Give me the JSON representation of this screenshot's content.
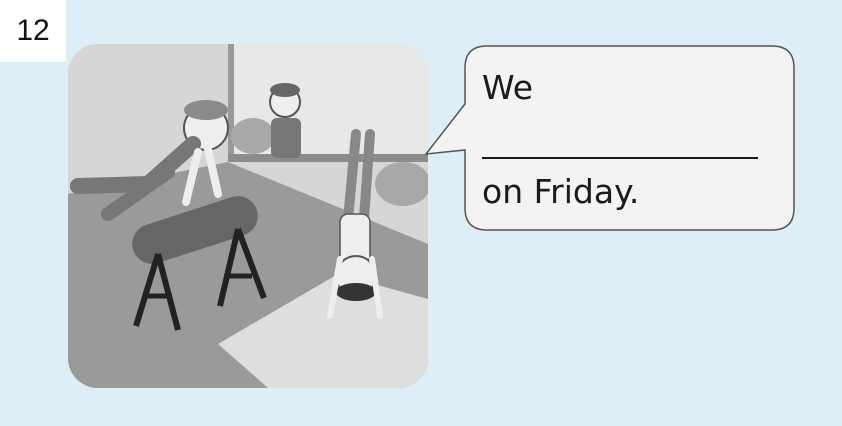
{
  "exercise": {
    "number": "12"
  },
  "speech_bubble": {
    "line_start": "We",
    "line_end": "on Friday."
  }
}
